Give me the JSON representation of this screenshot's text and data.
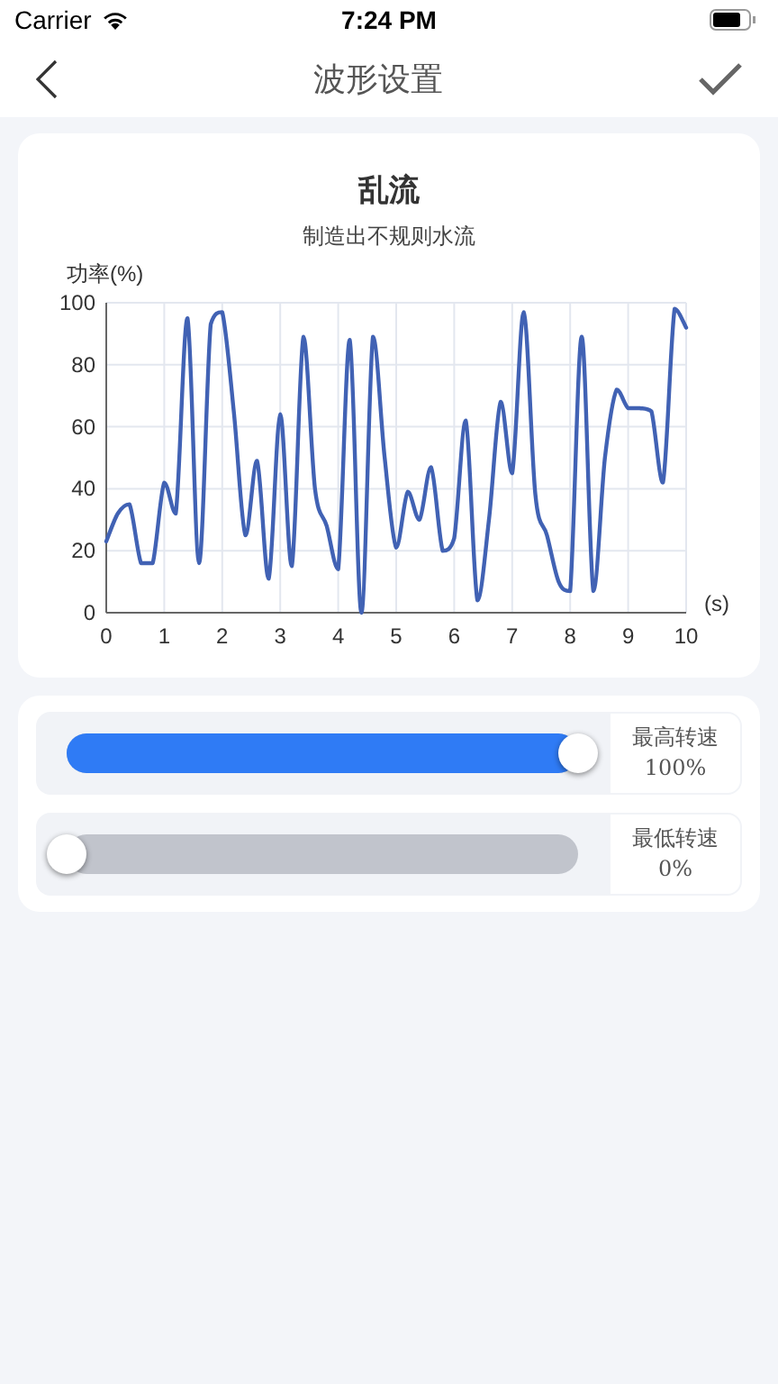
{
  "status_bar": {
    "carrier": "Carrier",
    "time": "7:24 PM"
  },
  "nav_bar": {
    "title": "波形设置"
  },
  "wave_card": {
    "title": "乱流",
    "subtitle": "制造出不规则水流",
    "chart_data": {
      "type": "line",
      "ylabel": "功率(%)",
      "xlabel": "(s)",
      "x": [
        0,
        0.2,
        0.4,
        0.6,
        0.8,
        1,
        1.2,
        1.4,
        1.6,
        1.8,
        2,
        2.2,
        2.4,
        2.6,
        2.8,
        3,
        3.2,
        3.4,
        3.6,
        3.8,
        4,
        4.2,
        4.4,
        4.6,
        4.8,
        5,
        5.2,
        5.4,
        5.6,
        5.8,
        6,
        6.2,
        6.4,
        6.6,
        6.8,
        7,
        7.2,
        7.4,
        7.6,
        7.8,
        8,
        8.2,
        8.4,
        8.6,
        8.8,
        9,
        9.2,
        9.4,
        9.6,
        9.8,
        10
      ],
      "series": [
        {
          "color": "#4162b4",
          "values": [
            23,
            32,
            35,
            16,
            16,
            42,
            32,
            95,
            16,
            93,
            97,
            65,
            25,
            49,
            11,
            64,
            15,
            89,
            40,
            28,
            14,
            88,
            0,
            89,
            50,
            21,
            39,
            30,
            47,
            20,
            24,
            62,
            4,
            30,
            68,
            45,
            97,
            38,
            25,
            10,
            7,
            89,
            7,
            50,
            72,
            66,
            66,
            65,
            42,
            98,
            92
          ]
        }
      ],
      "grid": true,
      "xlim": [
        0,
        10
      ],
      "ylim": [
        0,
        100
      ],
      "xticks": [
        0,
        1,
        2,
        3,
        4,
        5,
        6,
        7,
        8,
        9,
        10
      ],
      "yticks": [
        0,
        20,
        40,
        60,
        80,
        100
      ]
    }
  },
  "speed_sliders": [
    {
      "label": "最高转速",
      "reading": "100%",
      "level": 1
    },
    {
      "label": "最低转速",
      "reading": "0%",
      "level": 0
    }
  ]
}
